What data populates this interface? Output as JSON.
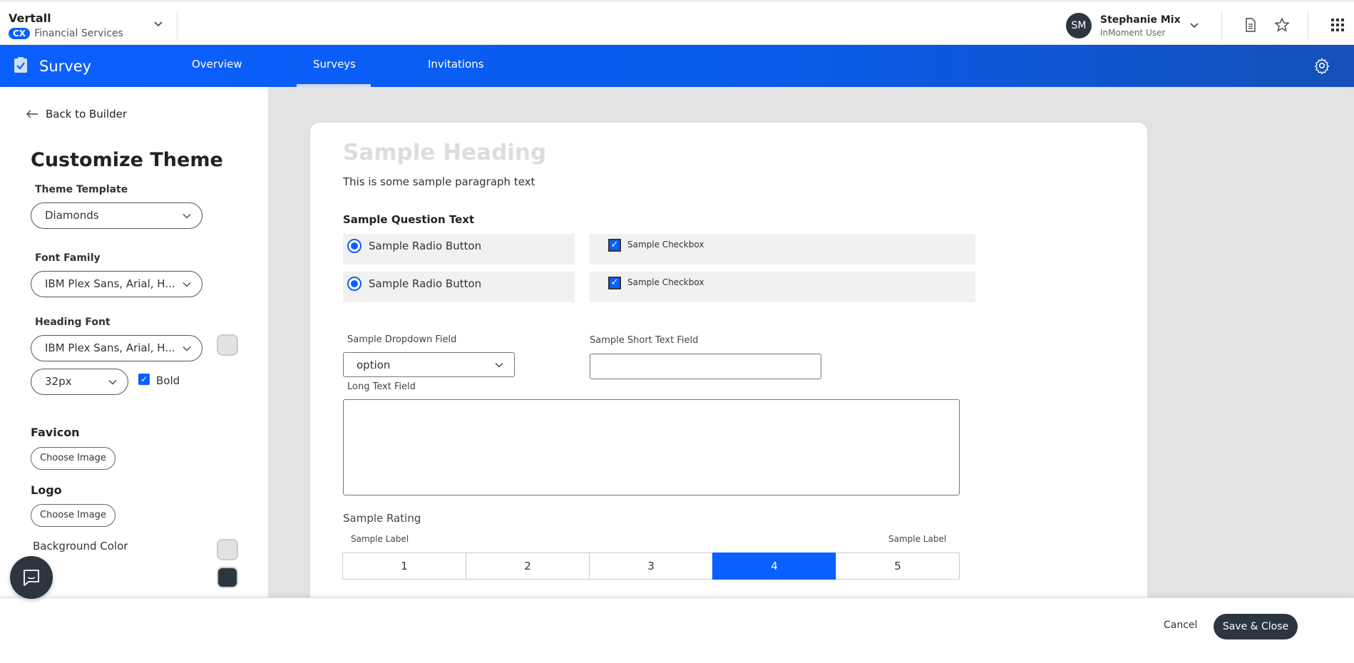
{
  "header": {
    "org_name": "Vertall",
    "org_badge": "CX",
    "org_sub": "Financial Services",
    "user_initials": "SM",
    "user_name": "Stephanie Mix",
    "user_role": "InMoment User",
    "icons": [
      "chevron-down-icon",
      "document-icon",
      "star-icon",
      "apps-grid-icon"
    ]
  },
  "nav": {
    "title": "Survey",
    "tabs": [
      {
        "label": "Overview",
        "active": false
      },
      {
        "label": "Surveys",
        "active": true
      },
      {
        "label": "Invitations",
        "active": false
      }
    ]
  },
  "sidebar": {
    "back_label": "Back to Builder",
    "title": "Customize Theme",
    "theme_template_label": "Theme Template",
    "theme_template_value": "Diamonds",
    "font_family_label": "Font Family",
    "font_family_value": "IBM Plex Sans, Arial, H...",
    "heading_font_label": "Heading Font",
    "heading_font_value": "IBM Plex Sans, Arial, H...",
    "heading_size_value": "32px",
    "bold_label": "Bold",
    "bold_checked": true,
    "favicon_label": "Favicon",
    "favicon_button": "Choose Image",
    "logo_label": "Logo",
    "logo_button": "Choose Image",
    "background_color_label": "Background Color",
    "colors": {
      "heading_swatch": "#e2e2e2",
      "background_swatch": "#e2e2e2",
      "text_swatch": "#2b3640"
    }
  },
  "preview": {
    "heading": "Sample Heading",
    "paragraph": "This is some sample paragraph text",
    "question": "Sample Question Text",
    "radios": [
      "Sample Radio Button",
      "Sample Radio Button"
    ],
    "checkboxes": [
      "Sample Checkbox",
      "Sample Checkbox"
    ],
    "dropdown_label": "Sample Dropdown Field",
    "dropdown_value": "option",
    "short_text_label": "Sample Short Text Field",
    "long_text_label": "Long Text Field",
    "rating_title": "Sample Rating",
    "rating_left_label": "Sample Label",
    "rating_right_label": "Sample Label",
    "rating_values": [
      "1",
      "2",
      "3",
      "4",
      "5"
    ],
    "rating_selected": "4"
  },
  "footer": {
    "cancel_label": "Cancel",
    "save_label": "Save & Close"
  },
  "colors": {
    "accent": "#0a5fff",
    "dark": "#2b3640"
  }
}
